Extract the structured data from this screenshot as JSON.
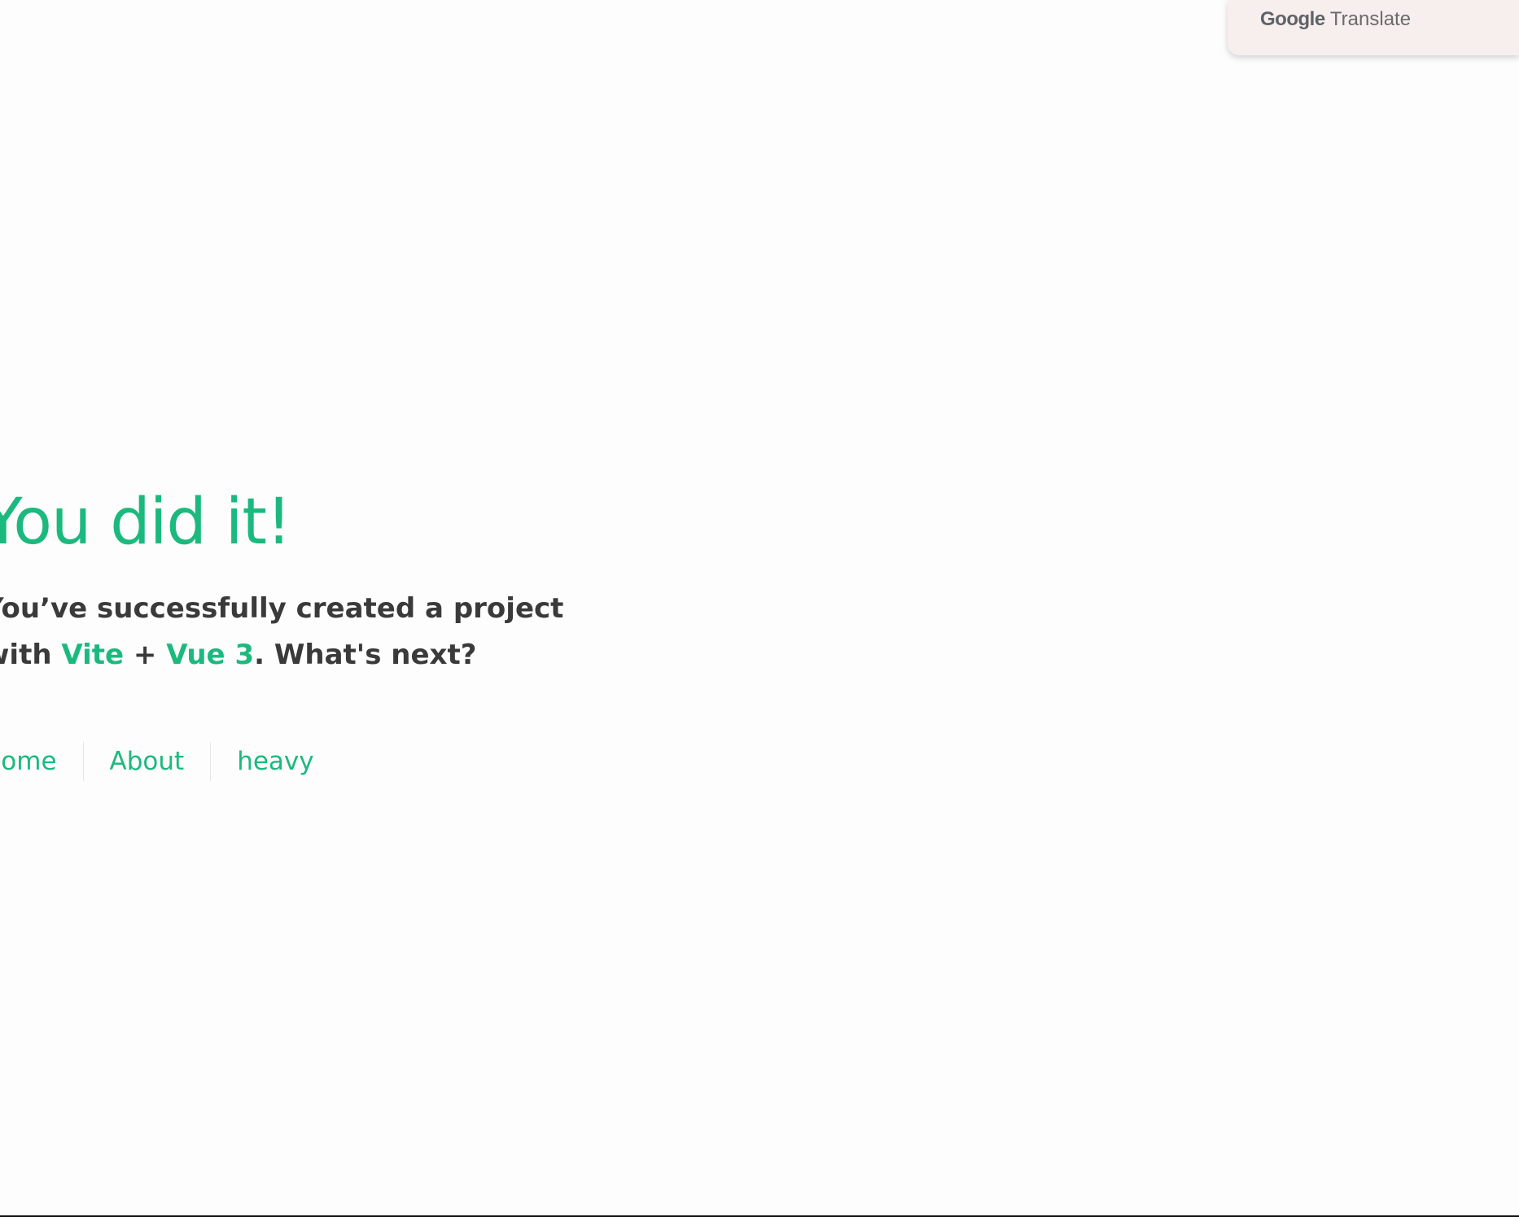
{
  "translate_widget": {
    "brand": "Google",
    "product": "Translate"
  },
  "hero": {
    "title": "You did it!",
    "subtitle": {
      "line1": "You’ve successfully created a project",
      "prefix": "with",
      "link1": "Vite",
      "plus": "+",
      "link2": "Vue 3",
      "suffix": ". What's next?"
    }
  },
  "nav": {
    "items": [
      {
        "label": "Home"
      },
      {
        "label": "About"
      },
      {
        "label": "heavy"
      }
    ]
  },
  "colors": {
    "accent": "#1cb97f",
    "text": "#3a3a3a",
    "background": "#fdfdfd",
    "translate_bar": "#f7eeee"
  }
}
